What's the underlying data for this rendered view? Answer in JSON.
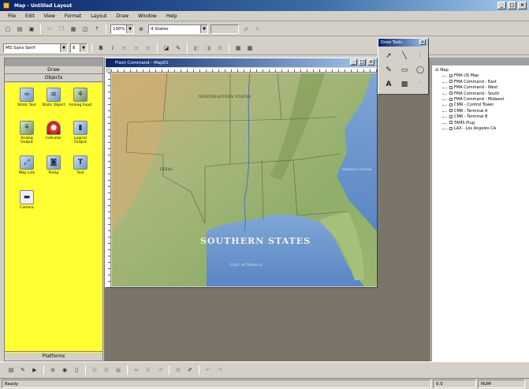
{
  "window": {
    "title": "Map - Untitled Layout",
    "min": "_",
    "max": "□",
    "close": "×"
  },
  "menu": [
    "File",
    "Edit",
    "View",
    "Format",
    "Layout",
    "Draw",
    "Window",
    "Help"
  ],
  "toolbar1": {
    "zoom_value": "100%",
    "layer_value": "4 States",
    "extra_value": ""
  },
  "toolbar2": {
    "font_value": "MS Sans Serif",
    "size_value": "8"
  },
  "left_panel": {
    "header": "",
    "section_top": "Draw",
    "section_objects": "Objects",
    "bottom": "Platforms",
    "items": [
      {
        "label": "Static Text",
        "icon": "static-text-icon"
      },
      {
        "label": "Static Object",
        "icon": "static-object-icon"
      },
      {
        "label": "Analog Input",
        "icon": "analog-input-icon"
      },
      {
        "label": "Analog Output",
        "icon": "analog-output-icon"
      },
      {
        "label": "Indicator",
        "icon": "indicator-icon"
      },
      {
        "label": "Logical Output",
        "icon": "logical-output-icon"
      },
      {
        "label": "Map Link",
        "icon": "map-link-icon"
      },
      {
        "label": "Pump",
        "icon": "pump-icon"
      },
      {
        "label": "Text",
        "icon": "text-icon"
      },
      {
        "label": "Camera",
        "icon": "camera-icon"
      }
    ]
  },
  "map_window": {
    "title": "Fleet Command - Map01",
    "region_label": "SOUTHERN STATES",
    "gulf_label": "Gulf of Mexico",
    "ocean_label": "Atlantic Ocean"
  },
  "draw_palette": {
    "title": "Draw Tools"
  },
  "right_panel": {
    "header": "",
    "root": "Map",
    "items": [
      "FMA US Map",
      "FMA Command - East",
      "FMA Command - West",
      "FMA Command - South",
      "FMA Command - Midwest",
      "CMR - Control Tower",
      "CMR - Terminal A",
      "CMR - Terminal B",
      "TAMS Plug",
      "LAX - Los Angeles CA"
    ]
  },
  "status": {
    "left": "Ready",
    "coord": "0.0",
    "right": "NUM"
  },
  "colors": {
    "palette_bg": "#ffff33",
    "mdi_bg": "#7a7469",
    "titlebar": "#0a246a"
  }
}
